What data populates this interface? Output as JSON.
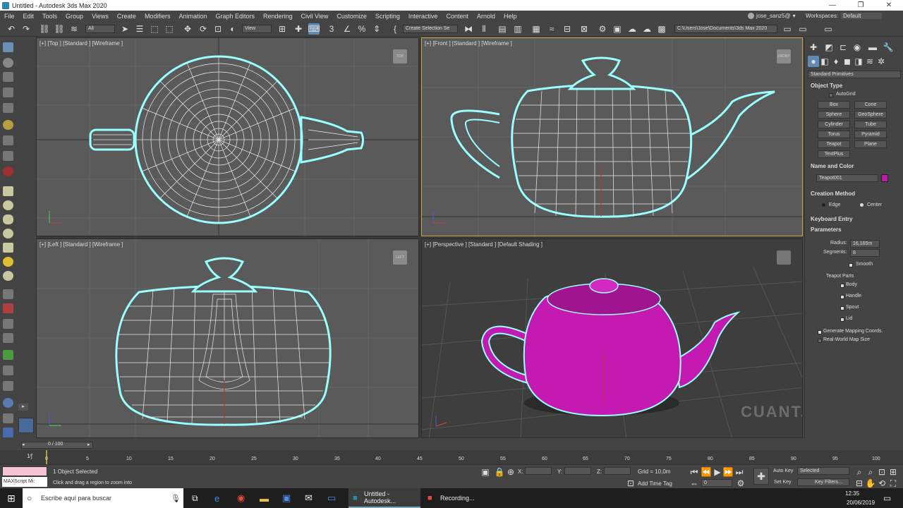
{
  "window": {
    "title": "Untitled - Autodesk 3ds Max 2020",
    "minimize": "—",
    "maximize": "❐",
    "close": "✕"
  },
  "menu": [
    "File",
    "Edit",
    "Tools",
    "Group",
    "Views",
    "Create",
    "Modifiers",
    "Animation",
    "Graph Editors",
    "Rendering",
    "Civil View",
    "Customize",
    "Scripting",
    "Interactive",
    "Content",
    "Arnold",
    "Help"
  ],
  "user": {
    "name": "jose_sanz5@",
    "workspace_label": "Workspaces:",
    "workspace": "Default"
  },
  "toolbar": {
    "filter": "All",
    "view": "View",
    "selection_set": "Create Selection Se",
    "path": "C:\\Users\\Jose\\Documents\\3ds Max 2020"
  },
  "viewports": {
    "top": {
      "label": "[+] [Top ] [Standard ] [Wireframe ]",
      "cube": "TOP"
    },
    "front": {
      "label": "[+] [Front ] [Standard ] [Wireframe ]",
      "cube": "FRONT"
    },
    "left": {
      "label": "[+] [Left ] [Standard ] [Wireframe ]",
      "cube": "LEFT"
    },
    "persp": {
      "label": "[+] [Perspective ] [Standard ] [Default Shading ]"
    }
  },
  "watermark": "CUANT.CO",
  "command_panel": {
    "category": "Standard Primitives",
    "object_type": "Object Type",
    "autogrid": "AutoGrid",
    "buttons": [
      "Box",
      "Cone",
      "Sphere",
      "GeoSphere",
      "Cylinder",
      "Tube",
      "Torus",
      "Pyramid",
      "Teapot",
      "Plane",
      "TextPlus"
    ],
    "name_and_color": "Name and Color",
    "object_name": "Teapot001",
    "object_color": "#c01aa8",
    "creation_method": "Creation Method",
    "edge": "Edge",
    "center": "Center",
    "keyboard_entry": "Keyboard Entry",
    "parameters": "Parameters",
    "radius_label": "Radius:",
    "radius": "16,165m",
    "segments_label": "Segments:",
    "segments": "8",
    "smooth": "Smooth",
    "teapot_parts": "Teapot Parts",
    "parts": [
      "Body",
      "Handle",
      "Spout",
      "Lid"
    ],
    "gen_mapping": "Generate Mapping Coords.",
    "real_world": "Real-World Map Size"
  },
  "time": {
    "slider": "0 / 100",
    "ticks": [
      "0",
      "5",
      "10",
      "15",
      "20",
      "25",
      "30",
      "35",
      "40",
      "45",
      "50",
      "55",
      "60",
      "65",
      "70",
      "75",
      "80",
      "85",
      "90",
      "95",
      "100"
    ]
  },
  "status": {
    "selected": "1 Object Selected",
    "hint": "Click and drag a region to zoom into",
    "maxscript": "MAXScript Mi:",
    "x_label": "X:",
    "y_label": "Y:",
    "z_label": "Z:",
    "grid": "Grid = 10,0m",
    "add_time_tag": "Add Time Tag",
    "auto_key": "Auto Key",
    "set_key": "Set Key",
    "selected_dd": "Selected",
    "key_filters": "Key Filters...",
    "frame": "0"
  },
  "taskbar": {
    "search": "Escribe aquí para buscar",
    "app1": "Untitled - Autodesk...",
    "app2": "Recording...",
    "time": "12:35",
    "date": "20/06/2019"
  }
}
